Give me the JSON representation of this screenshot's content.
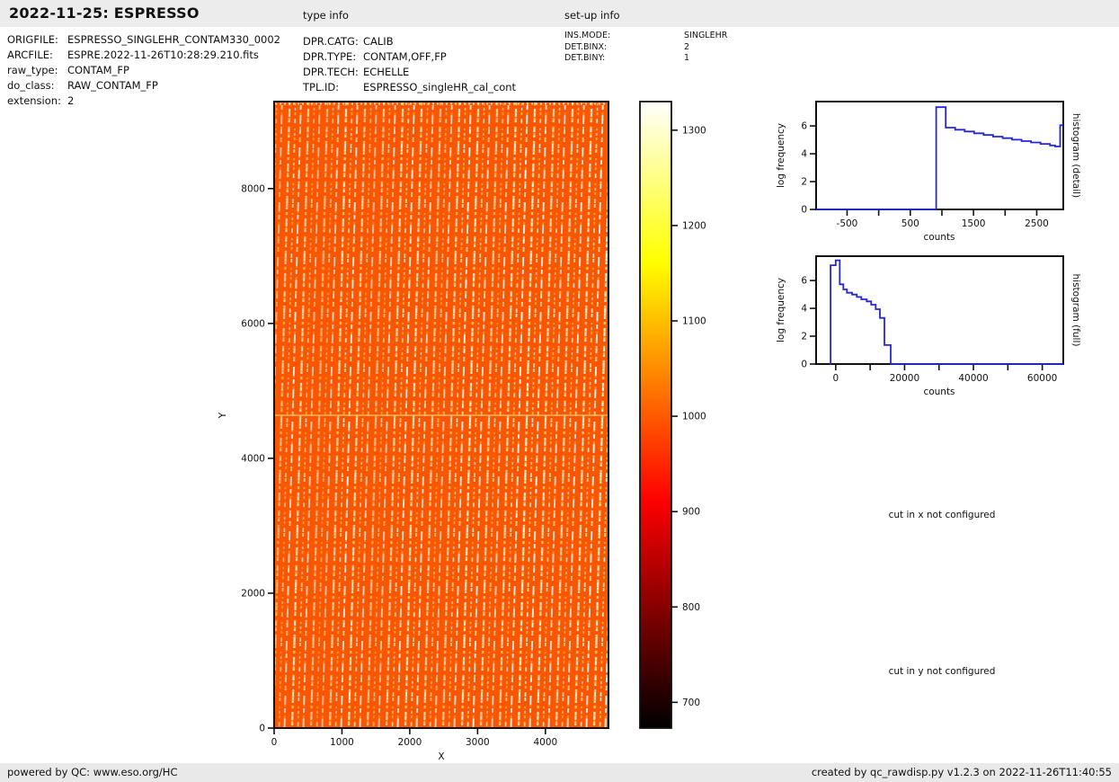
{
  "header": {
    "title": "2022-11-25: ESPRESSO",
    "type_info_label": "type info",
    "setup_info_label": "set-up info"
  },
  "file_info": {
    "rows": [
      {
        "label": "ORIGFILE:",
        "value": "ESPRESSO_SINGLEHR_CONTAM330_0002"
      },
      {
        "label": "ARCFILE:",
        "value": "ESPRE.2022-11-26T10:28:29.210.fits"
      },
      {
        "label": "raw_type:",
        "value": "CONTAM_FP"
      },
      {
        "label": "do_class:",
        "value": "RAW_CONTAM_FP"
      },
      {
        "label": "extension:",
        "value": "2"
      }
    ]
  },
  "type_info": {
    "rows": [
      {
        "label": "DPR.CATG:",
        "value": "CALIB"
      },
      {
        "label": "DPR.TYPE:",
        "value": "CONTAM,OFF,FP"
      },
      {
        "label": "DPR.TECH:",
        "value": "ECHELLE"
      },
      {
        "label": "TPL.ID:",
        "value": "ESPRESSO_singleHR_cal_cont"
      }
    ]
  },
  "setup_info": {
    "rows": [
      {
        "label": "INS.MODE:",
        "value": "SINGLEHR"
      },
      {
        "label": "DET.BINX:",
        "value": "2"
      },
      {
        "label": "DET.BINY:",
        "value": "1"
      }
    ]
  },
  "messages": {
    "cut_x": "cut in x not configured",
    "cut_y": "cut in y not configured"
  },
  "footer": {
    "left": "powered by QC: www.eso.org/HC",
    "right": "created by qc_rawdisp.py v1.2.3 on 2022-11-26T11:40:55"
  },
  "colors": {
    "header_bg": "#ececec",
    "footer_bg": "#e9e9e9",
    "image_background": "#fa5602",
    "histogram_line": "#2626d8",
    "axis": "#111111"
  },
  "chart_data": [
    {
      "id": "raw_image",
      "type": "heatmap",
      "title": "",
      "xlabel": "X",
      "ylabel": "Y",
      "xlim": [
        0,
        4930
      ],
      "ylim": [
        0,
        9290
      ],
      "xticks": [
        0,
        1000,
        2000,
        3000,
        4000
      ],
      "yticks": [
        0,
        2000,
        4000,
        6000,
        8000
      ],
      "colormap": "hot",
      "background_value": 1000,
      "seam_y": 4640,
      "description": "ESPRESSO raw echelle CONTAM_FP frame: dense, slightly tilted vertical dotted order traces (white/yellow Fabry-Perot lines) on an ~1000-count orange background, with a brighter horizontal detector seam near Y=4640"
    },
    {
      "id": "colorbar",
      "type": "colorbar",
      "lim": [
        673,
        1330
      ],
      "ticks": [
        700,
        800,
        900,
        1000,
        1100,
        1200,
        1300
      ],
      "colormap_stops": [
        {
          "value": 1330,
          "color": "#ffffff"
        },
        {
          "value": 1300,
          "color": "#ffffd1"
        },
        {
          "value": 1250,
          "color": "#ffff85"
        },
        {
          "value": 1200,
          "color": "#ffff38"
        },
        {
          "value": 1162,
          "color": "#ffff00"
        },
        {
          "value": 1100,
          "color": "#ffbf00"
        },
        {
          "value": 1050,
          "color": "#ff8c00"
        },
        {
          "value": 1000,
          "color": "#ff5900"
        },
        {
          "value": 950,
          "color": "#ff2600"
        },
        {
          "value": 911,
          "color": "#fd0000"
        },
        {
          "value": 850,
          "color": "#bc0000"
        },
        {
          "value": 800,
          "color": "#870000"
        },
        {
          "value": 750,
          "color": "#520000"
        },
        {
          "value": 700,
          "color": "#1d0000"
        },
        {
          "value": 673,
          "color": "#000000"
        }
      ]
    },
    {
      "id": "hist_detail",
      "type": "line",
      "xlabel": "counts",
      "ylabel": "log frequency",
      "right_label": "histogram (detail)",
      "xlim": [
        -990,
        2920
      ],
      "ylim": [
        0,
        7.75
      ],
      "xticks": [
        -500,
        500,
        1500,
        2500
      ],
      "xticks_minor": [
        0,
        1000,
        2000
      ],
      "yticks": [
        0,
        2,
        4,
        6
      ],
      "line_color": "#2626d8",
      "points": [
        [
          -990,
          0
        ],
        [
          910,
          0
        ],
        [
          910,
          7.35
        ],
        [
          1060,
          7.35
        ],
        [
          1060,
          5.88
        ],
        [
          1210,
          5.88
        ],
        [
          1210,
          5.73
        ],
        [
          1360,
          5.73
        ],
        [
          1360,
          5.6
        ],
        [
          1510,
          5.6
        ],
        [
          1510,
          5.47
        ],
        [
          1660,
          5.47
        ],
        [
          1660,
          5.35
        ],
        [
          1810,
          5.35
        ],
        [
          1810,
          5.23
        ],
        [
          1960,
          5.23
        ],
        [
          1960,
          5.12
        ],
        [
          2110,
          5.12
        ],
        [
          2110,
          5.01
        ],
        [
          2260,
          5.01
        ],
        [
          2260,
          4.91
        ],
        [
          2410,
          4.91
        ],
        [
          2410,
          4.81
        ],
        [
          2560,
          4.81
        ],
        [
          2560,
          4.71
        ],
        [
          2710,
          4.71
        ],
        [
          2710,
          4.6
        ],
        [
          2790,
          4.6
        ],
        [
          2790,
          4.52
        ],
        [
          2870,
          4.52
        ],
        [
          2870,
          6.05
        ],
        [
          2920,
          6.05
        ]
      ]
    },
    {
      "id": "hist_full",
      "type": "line",
      "xlabel": "counts",
      "ylabel": "log frequency",
      "right_label": "histogram (full)",
      "xlim": [
        -5700,
        66100
      ],
      "ylim": [
        0,
        7.75
      ],
      "xticks": [
        0,
        20000,
        40000,
        60000
      ],
      "xticks_minor": [
        10000,
        30000,
        50000
      ],
      "yticks": [
        0,
        2,
        4,
        6
      ],
      "line_color": "#2626d8",
      "points": [
        [
          -1700,
          0
        ],
        [
          -1500,
          0
        ],
        [
          -1500,
          7.1
        ],
        [
          0,
          7.1
        ],
        [
          0,
          7.45
        ],
        [
          1175,
          7.45
        ],
        [
          1175,
          5.73
        ],
        [
          2220,
          5.73
        ],
        [
          2220,
          5.36
        ],
        [
          3265,
          5.36
        ],
        [
          3265,
          5.12
        ],
        [
          4750,
          5.12
        ],
        [
          4750,
          4.99
        ],
        [
          6135,
          4.99
        ],
        [
          6135,
          4.82
        ],
        [
          7440,
          4.82
        ],
        [
          7440,
          4.65
        ],
        [
          9010,
          4.65
        ],
        [
          9010,
          4.5
        ],
        [
          10315,
          4.5
        ],
        [
          10315,
          4.26
        ],
        [
          11620,
          4.26
        ],
        [
          11620,
          3.94
        ],
        [
          12845,
          3.94
        ],
        [
          12845,
          3.31
        ],
        [
          14150,
          3.31
        ],
        [
          14150,
          1.36
        ],
        [
          15980,
          1.36
        ],
        [
          15980,
          0
        ],
        [
          66100,
          0
        ]
      ]
    }
  ]
}
